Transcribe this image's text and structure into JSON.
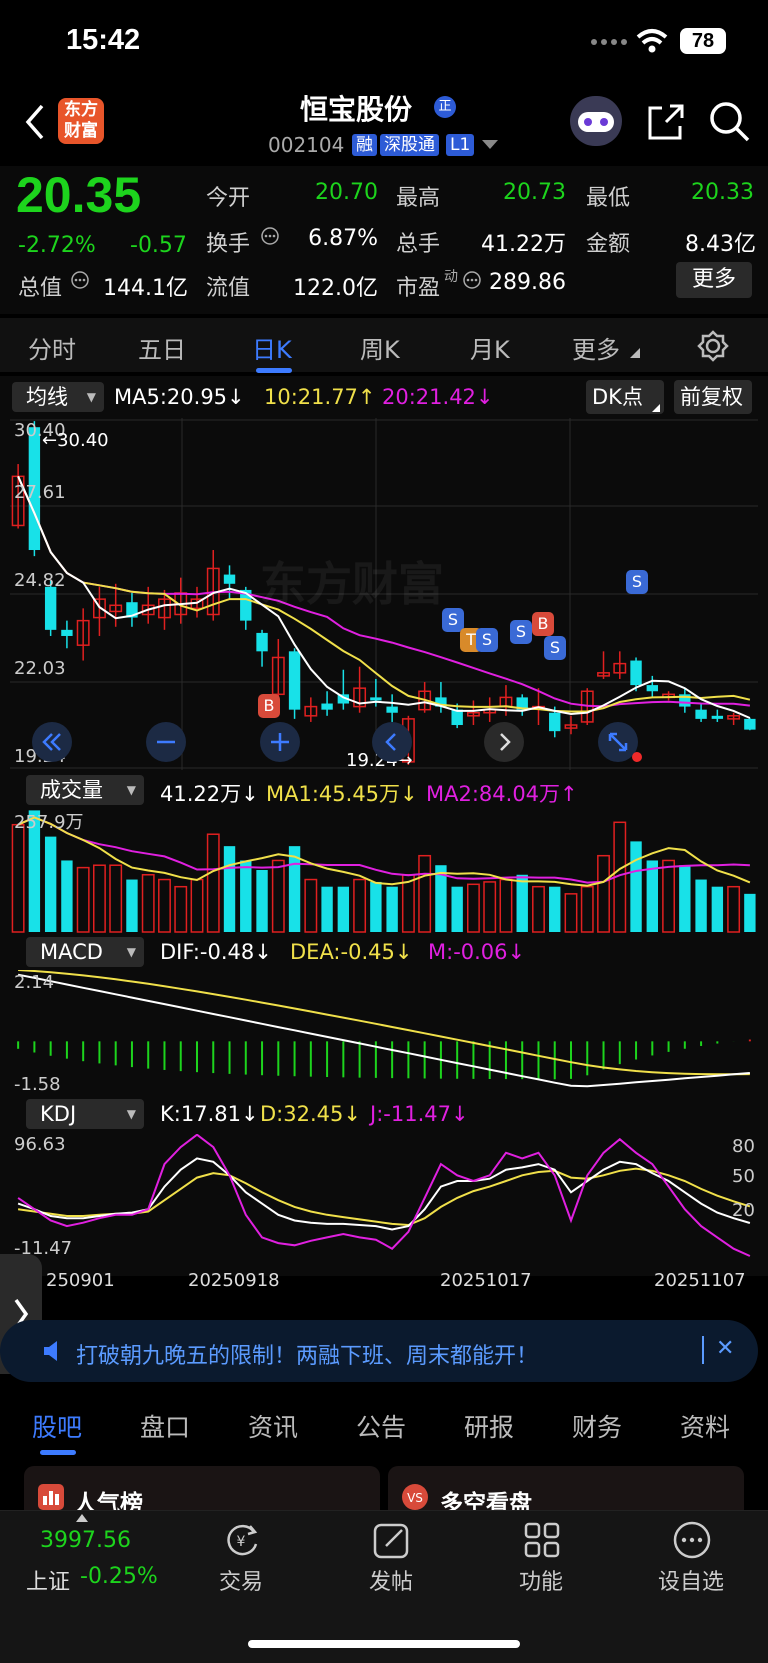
{
  "status": {
    "time": "15:42",
    "battery": "78"
  },
  "header": {
    "back_label": "<",
    "logo_text": "东方财富",
    "stock_name": "恒宝股份",
    "badge": "正",
    "code": "002104",
    "tags": [
      "融",
      "深股通",
      "L1"
    ]
  },
  "quote": {
    "price": "20.35",
    "change_pct": "-2.72%",
    "change": "-0.57",
    "open_label": "今开",
    "open": "20.70",
    "high_label": "最高",
    "high": "20.73",
    "low_label": "最低",
    "low": "20.33",
    "turnover_label": "换手",
    "turnover": "6.87%",
    "volume_label": "总手",
    "volume": "41.22万",
    "amount_label": "金额",
    "amount": "8.43亿",
    "mktcap_label": "总值",
    "mktcap": "144.1亿",
    "float_label": "流值",
    "float": "122.0亿",
    "pe_label": "市盈",
    "pe_sup": "动",
    "pe": "289.86",
    "more_label": "更多"
  },
  "period_tabs": [
    "分时",
    "五日",
    "日K",
    "周K",
    "月K",
    "更多"
  ],
  "active_tab": "日K",
  "colors": {
    "up": "#e02020",
    "down": "#18e1e8",
    "ma5": "#ffffff",
    "ma10": "#f0e04a",
    "ma20": "#e020e0",
    "green": "#1dd41d"
  },
  "main_chart": {
    "indicator_select": "均线",
    "ma5": "MA5:20.95↓",
    "ma10": "10:21.77↑",
    "ma20": "20:21.42↓",
    "dk_label": "DK点",
    "adjust_label": "前复权",
    "y_ticks": [
      "30.40",
      "27.61",
      "24.82",
      "22.03",
      "19.24"
    ],
    "max_label": "←30.40",
    "min_label": "19.24→",
    "markers": [
      "B",
      "B",
      "S",
      "T",
      "S",
      "S",
      "B",
      "S",
      "S"
    ],
    "watermark": "东方财富"
  },
  "volume_chart": {
    "indicator_select": "成交量",
    "vol": "41.22万↓",
    "ma1": "MA1:45.45万↓",
    "ma2": "MA2:84.04万↑",
    "y_top": "257.9万"
  },
  "macd_chart": {
    "indicator_select": "MACD",
    "dif": "DIF:-0.48↓",
    "dea": "DEA:-0.45↓",
    "m": "M:-0.06↓",
    "y_top": "2.14",
    "y_bottom": "-1.58"
  },
  "kdj_chart": {
    "indicator_select": "KDJ",
    "k": "K:17.81↓",
    "d": "D:32.45↓",
    "j": "J:-11.47↓",
    "y_top": "96.63",
    "y_bottom": "-11.47",
    "right_ticks": [
      "80",
      "50",
      "20"
    ]
  },
  "x_dates": [
    "250901",
    "20250918",
    "20251017",
    "20251107"
  ],
  "banner": {
    "text": "打破朝九晚五的限制！两融下班、周末都能开！",
    "close": "✕"
  },
  "sub_tabs": [
    "股吧",
    "盘口",
    "资讯",
    "公告",
    "研报",
    "财务",
    "资料"
  ],
  "cards": [
    "人气榜",
    "多空看盘"
  ],
  "bottom_nav": {
    "index_value": "3997.56",
    "index_name": "上证",
    "index_change": "-0.25%",
    "items": [
      "交易",
      "发帖",
      "功能",
      "设自选"
    ]
  }
}
